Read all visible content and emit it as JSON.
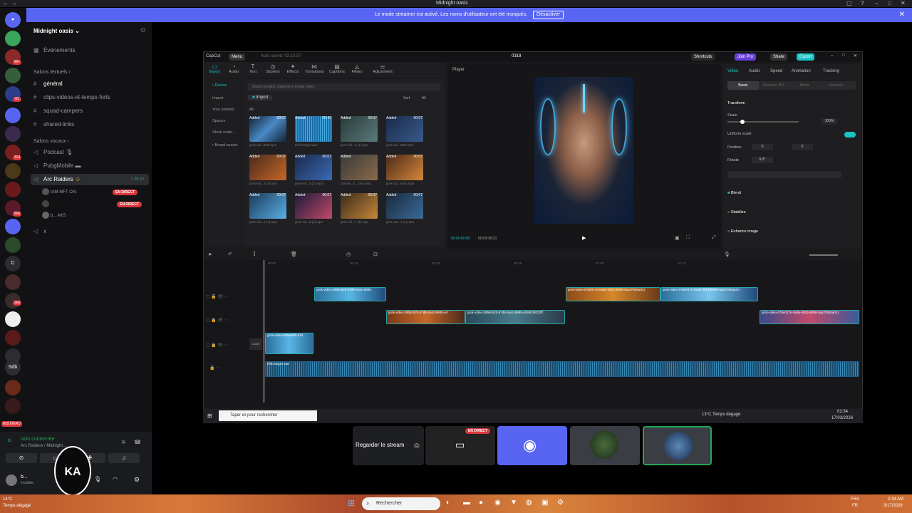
{
  "window": {
    "title": "Midnight oasis"
  },
  "banner": {
    "text": "Le mode streamer est activé. Les noms d'utilisateur ont été tronqués.",
    "button": "Désactiver"
  },
  "rail": {
    "badges": [
      "99+",
      "81",
      "314",
      "806",
      "360"
    ],
    "labels": [
      "C",
      "Sdb"
    ],
    "new_label": "NOUVEAU"
  },
  "server": {
    "name": "Midnight oasis"
  },
  "sidebar": {
    "events": "Événements",
    "text_category": "Salons textuels",
    "text_channels": [
      "général",
      "clips-vidéos-et-temps-forts",
      "squad-campers",
      "shared-links"
    ],
    "voice_category": "Salons vocaux",
    "voice_channels": [
      "Podcast",
      "PubgMobile",
      "Arc Raiders"
    ],
    "arc_time": "7:28:37",
    "members": [
      "IAM-MFT",
      "",
      "b..."
    ],
    "member_tags": [
      "OAI",
      "",
      "AKS"
    ],
    "live_label": "EN DIRECT",
    "extra_channel": "x"
  },
  "voice": {
    "connected": "Voix connectée",
    "location": "Arc Raiders / Midnight..."
  },
  "user": {
    "name": "b...",
    "status": "Invisible"
  },
  "capcut": {
    "logo": "CapCut",
    "menu": "Menu",
    "autosave": "Auto saved: 02:10:57",
    "project": "0318",
    "shortcuts": "Shortcuts",
    "join_pro": "Join Pro",
    "share": "Share",
    "export": "Export",
    "tabs": [
      "Import",
      "Audio",
      "Text",
      "Stickers",
      "Effects",
      "Transitions",
      "Captions",
      "Filters",
      "Adjustment"
    ],
    "side": [
      "• Device",
      "Import",
      "Your presets",
      "Spaces",
      "Stock mate...",
      "• Brand assets"
    ],
    "search_placeholder": "Search project, subjects in image, lines",
    "import_btn": "Import",
    "sort": "Sort",
    "all": "All",
    "thumbs": [
      {
        "dur": "00:07",
        "cap": "grok-vid...58d.mp4"
      },
      {
        "dur": "00:40",
        "cap": "télécharger.wav"
      },
      {
        "dur": "00:07",
        "cap": "grok-vid...2 (1).mp4"
      },
      {
        "dur": "00:07",
        "cap": "grok-vid...33f0.mp4"
      },
      {
        "dur": "00:07",
        "cap": "grok-vid...4 (1).mp4"
      },
      {
        "dur": "00:07",
        "cap": "grok-vid...4 (2).mp4"
      },
      {
        "dur": "",
        "cap": "Gemini_G...1vso.png"
      },
      {
        "dur": "00:07",
        "cap": "grok-vid...ac61.mp4"
      },
      {
        "dur": "00:07",
        "cap": "grok-vid...3 (1).mp4"
      },
      {
        "dur": "00:07",
        "cap": "grok-vid...3 (2).mp4"
      },
      {
        "dur": "00:07",
        "cap": "grok-vid...7 (1).mp4"
      },
      {
        "dur": "00:07",
        "cap": "grok-vid...3 (1).mp4"
      }
    ],
    "added": "Added",
    "player": "Player",
    "time_current": "00:00:00:00",
    "time_total": "00:03:39:21",
    "prop_tabs": [
      "Video",
      "Audio",
      "Speed",
      "Animation",
      "Tracking"
    ],
    "sub_tabs": [
      "Basic",
      "Remove BG",
      "Mask",
      "Retouch"
    ],
    "transform": "Transform",
    "scale": "Scale",
    "scale_val": "100%",
    "uniform": "Uniform scale",
    "position": "Position",
    "pos_x": "0",
    "pos_y": "0",
    "rotate": "Rotate",
    "rotate_val": "0.0°",
    "blend": "Blend",
    "stabilize": "Stabilize",
    "enhance": "Enhance image",
    "ruler": [
      "00:00",
      "00:15",
      "00:30",
      "00:45",
      "01:00",
      "01:15"
    ],
    "clips": [
      "grok-video-29b8c520-67d8-4ea1-9885",
      "grok-video-07de017e-0ada-4913-8099-4aa37855acb1",
      "grok-video-07de017e-0ada-4913-8099-4aa37855acb1",
      "grok-video-29b8c520-67d8-4ea1-9885-ed",
      "grok-video-29b8c520-67d8-4ea1-9885-e249b39332ff",
      "grok-video-07de017e-0ada-4913-8099-4aa37855acb1",
      "grok-video-b9ba6fd0-d1d",
      "télécharger.wav"
    ],
    "cover": "Cover"
  },
  "inner_taskbar": {
    "search": "Taper ici pour rechercher",
    "weather": "13°C  Temps dégagé",
    "time": "02:34",
    "date": "17/03/2026"
  },
  "streams": {
    "watch": "Regarder le stream",
    "live": "EN DIRECT"
  },
  "taskbar": {
    "weather_temp": "14°C",
    "weather_desc": "Temps dégagé",
    "search": "Rechercher",
    "lang1": "FRA",
    "lang2": "FR",
    "time": "2:34 AM",
    "date": "3/17/2026"
  }
}
